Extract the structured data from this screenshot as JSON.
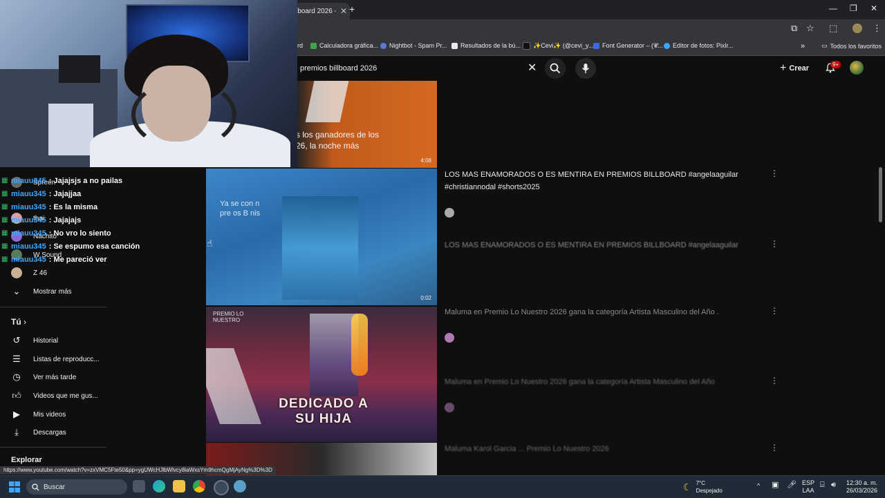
{
  "browser": {
    "tab_title": "lboard 2026 - Y",
    "bookmarks": [
      {
        "label": "rd",
        "color": "#888888"
      },
      {
        "label": "Calculadora gráfica...",
        "color": "#3ea64a"
      },
      {
        "label": "Nightbot - Spam Pr...",
        "color": "#5a7ad8"
      },
      {
        "label": "Resultados de la bú...",
        "color": "#e8eaed"
      },
      {
        "label": "✨Cevi✨ (@cevi_y...",
        "color": "#111111"
      },
      {
        "label": "Font Generator – (𝓒...",
        "color": "#3b6ae0"
      },
      {
        "label": "Editor de fotos: Pixlr...",
        "color": "#3ea6ff"
      }
    ],
    "all_favorites": "Todos los favoritos",
    "status_url": "https://www.youtube.com/watch?v=zxVMC5Fte50&pp=ygUWcHJlbWlvcy8iaWxsYm9hcmQgMjAyNg%3D%3D"
  },
  "youtube": {
    "search_query": "premios billboard 2026",
    "create_label": "Crear",
    "notifications_badge": "9+"
  },
  "chat": [
    {
      "user": "miauu345",
      "message": ": Jajajsjs a no pailas"
    },
    {
      "user": "miauu345",
      "message": ": Jajajjaa"
    },
    {
      "user": "miauu345",
      "message": ": Es la misma"
    },
    {
      "user": "miauu345",
      "message": ": Jajajajs"
    },
    {
      "user": "miauu345",
      "message": ": No vro lo siento"
    },
    {
      "user": "miauu345",
      "message": ": Se espumo esa canción"
    },
    {
      "user": "miauu345",
      "message": ": Me pareció ver"
    }
  ],
  "sidebar": {
    "subscriptions": [
      {
        "label": "Spreen",
        "color": "#6a6a6a"
      },
      {
        "label": "thai",
        "color": "#d8a0a0"
      },
      {
        "label": "Nachito",
        "color": "#8a6ad8"
      },
      {
        "label": "W Sound",
        "color": "#5a7a5a"
      },
      {
        "label": "Z 46",
        "color": "#c8b090"
      }
    ],
    "show_more": "Mostrar más",
    "you_section": "Tú",
    "you_items": [
      {
        "label": "Historial",
        "icon": "history-icon"
      },
      {
        "label": "Listas de reproducc...",
        "icon": "playlists-icon"
      },
      {
        "label": "Ver más tarde",
        "icon": "watch-later-icon"
      },
      {
        "label": "Videos que me gus...",
        "icon": "like-icon"
      },
      {
        "label": "Mis videos",
        "icon": "my-videos-icon"
      },
      {
        "label": "Descargas",
        "icon": "downloads-icon"
      }
    ],
    "explore_section": "Explorar"
  },
  "results": {
    "thumb1_caption_line1": "s los ganadores de los",
    "thumb1_caption_line2": "26, la noche más",
    "thumb1_duration": "4:08",
    "thumb2_caption_line1": "Ya se con      n",
    "thumb2_caption_line2": "pre  os B     nis",
    "thumb2_duration": "0:02",
    "thumb3_channel": "PREMIO LO NUESTRO",
    "thumb3_caption": "DEDICADO A SU HIJA",
    "titles": [
      "LOS MAS ENAMORADOS O ES MENTIRA EN PREMIOS BILLBOARD #angelaaguilar",
      "#christiannodal #shorts2025",
      "LOS MAS ENAMORADOS O ES MENTIRA EN PREMIOS BILLBOARD #angelaaguilar",
      "Maluma en Premio Lo Nuestro 2026 gana la categoría Artista Masculino del Año .",
      "Maluma en Premio Lo Nuestro 2026 gana la categoría Artista Masculino del Año",
      "Maluma Karol Garcia ... Premio Lo Nuestro 2026"
    ]
  },
  "taskbar": {
    "search_label": "Buscar",
    "weather_temp": "7°C",
    "weather_desc": "Despejado",
    "lang": "ESP",
    "lang2": "LAA",
    "time": "12:30 a. m.",
    "date": "26/03/2026"
  }
}
